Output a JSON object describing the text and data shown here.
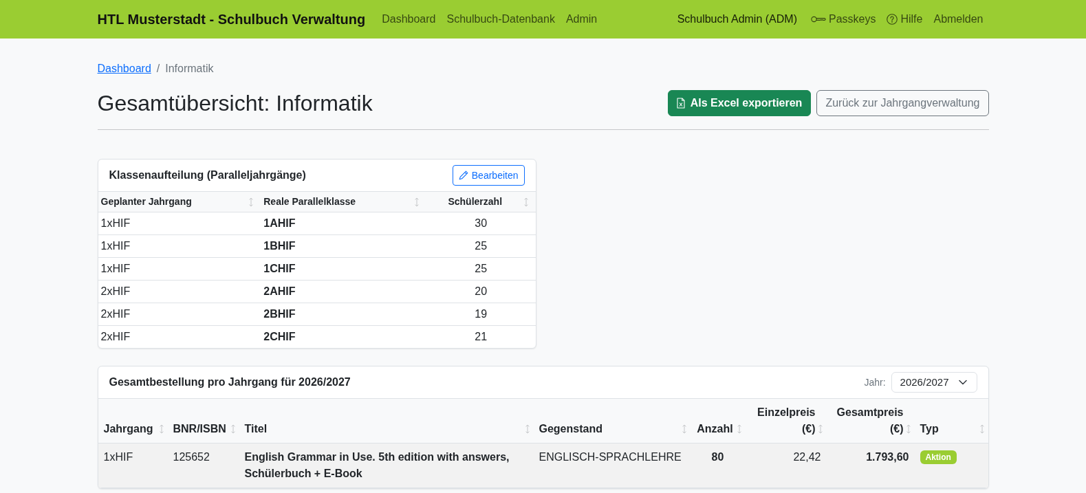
{
  "navbar": {
    "brand": "HTL Musterstadt - Schulbuch Verwaltung",
    "links": [
      {
        "label": "Dashboard"
      },
      {
        "label": "Schulbuch-Datenbank"
      },
      {
        "label": "Admin"
      }
    ],
    "user": "Schulbuch Admin (ADM)",
    "passkeys_link": "Passkeys",
    "help_link": "Hilfe",
    "logout_link": "Abmelden"
  },
  "breadcrumb": {
    "separator": "/",
    "items": [
      {
        "label": "Dashboard",
        "active": false
      },
      {
        "label": "Informatik",
        "active": true
      }
    ]
  },
  "page_title": "Gesamtübersicht: Informatik",
  "export_button": "Als Excel exportieren",
  "back_button": "Zurück zur Jahrgangverwaltung",
  "class_split": {
    "title": "Klassenaufteilung (Paralleljahrgänge)",
    "edit_button": "Bearbeiten",
    "columns": [
      "Geplanter Jahrgang",
      "Reale Parallelklasse",
      "Schülerzahl"
    ],
    "rows": [
      {
        "planned": "1xHIF",
        "class": "1AHIF",
        "students": "30"
      },
      {
        "planned": "1xHIF",
        "class": "1BHIF",
        "students": "25"
      },
      {
        "planned": "1xHIF",
        "class": "1CHIF",
        "students": "25"
      },
      {
        "planned": "2xHIF",
        "class": "2AHIF",
        "students": "20"
      },
      {
        "planned": "2xHIF",
        "class": "2BHIF",
        "students": "19"
      },
      {
        "planned": "2xHIF",
        "class": "2CHIF",
        "students": "21"
      }
    ]
  },
  "order": {
    "title": "Gesamtbestellung pro Jahrgang für 2026/2027",
    "year_label": "Jahr:",
    "year_value": "2026/2027",
    "columns": [
      "Jahrgang",
      "BNR/ISBN",
      "Titel",
      "Gegenstand",
      "Anzahl",
      "Einzelpreis (€)",
      "Gesamtpreis (€)",
      "Typ"
    ],
    "rows": [
      {
        "jahrgang": "1xHIF",
        "bnr": "125652",
        "title": "English Grammar in Use. 5th edition with answers, Schülerbuch + E-Book",
        "subject": "ENGLISCH-SPRACHLEHRE",
        "count": "80",
        "unit_price": "22,42",
        "total_price": "1.793,60",
        "type": "Aktion"
      }
    ]
  }
}
